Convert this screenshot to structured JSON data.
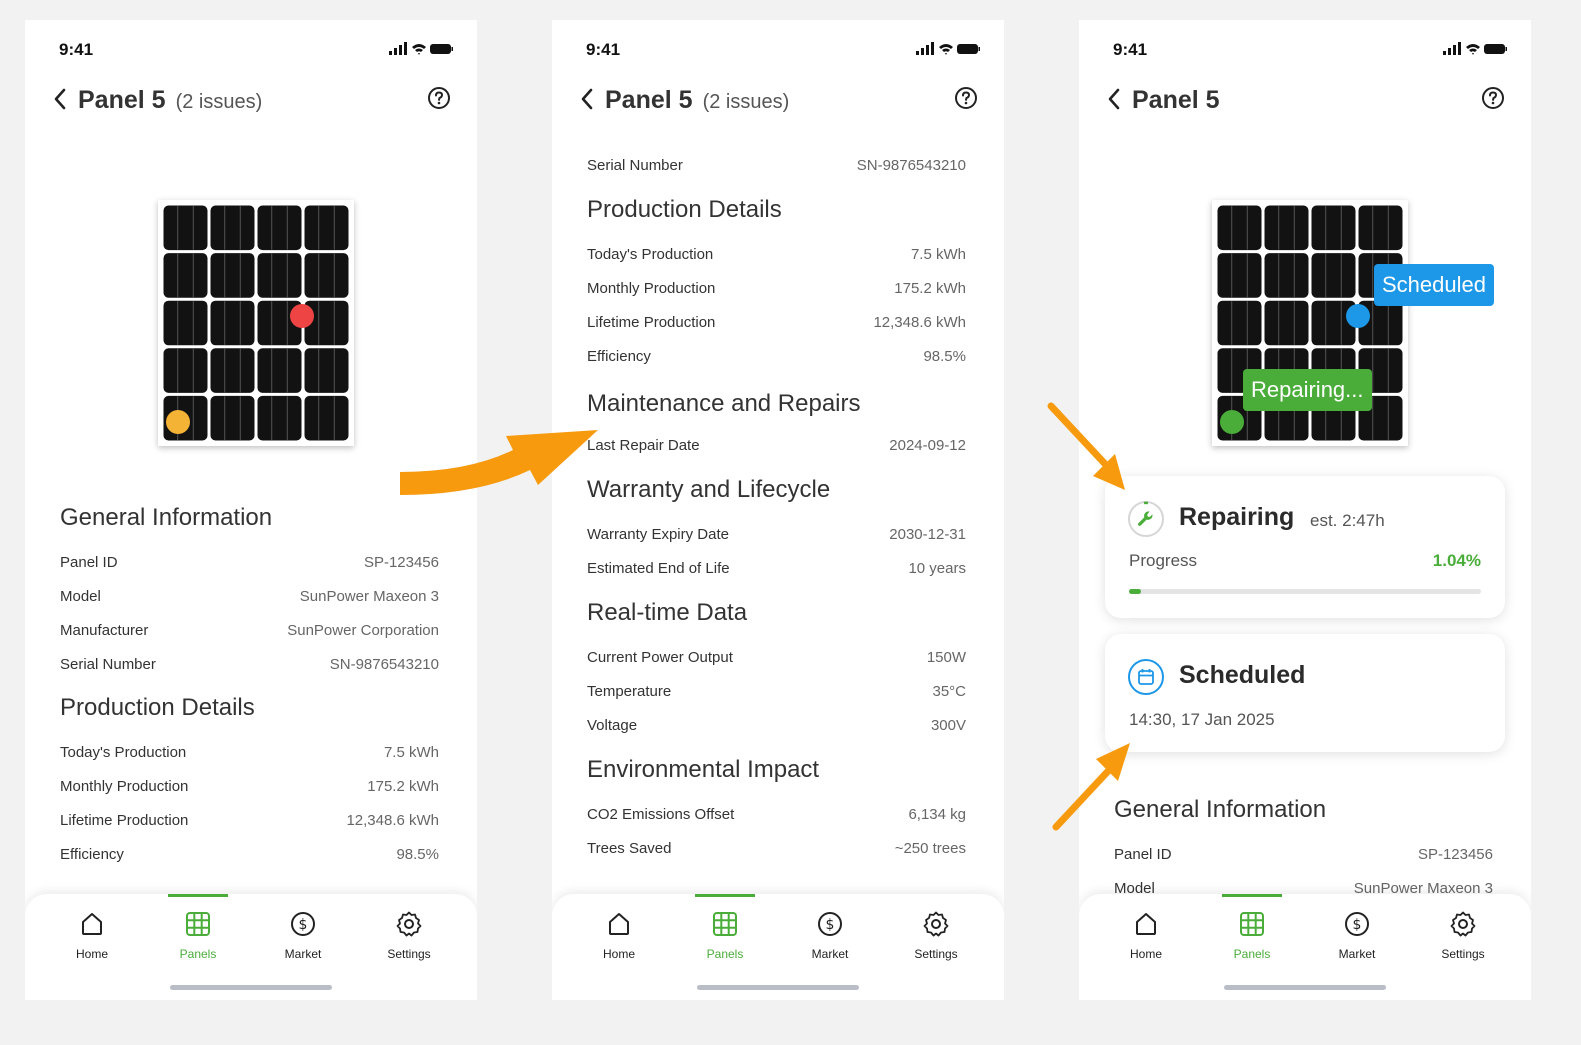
{
  "status": {
    "time": "9:41"
  },
  "colors": {
    "accent": "#4aad3a",
    "issue_red": "#ef4444",
    "issue_yellow": "#f5b335",
    "scheduled_blue": "#1d97e8",
    "arrow_orange": "#f79a0e"
  },
  "icons": {
    "back": "chevron-left-icon",
    "help": "question-circle-icon",
    "repair": "wrench-icon",
    "scheduled": "calendar-icon"
  },
  "screen1": {
    "title": "Panel 5",
    "issues": "(2 issues)",
    "general_title": "General Information",
    "general": [
      {
        "label": "Panel ID",
        "value": "SP-123456"
      },
      {
        "label": "Model",
        "value": "SunPower Maxeon 3"
      },
      {
        "label": "Manufacturer",
        "value": "SunPower Corporation"
      },
      {
        "label": "Serial Number",
        "value": "SN-9876543210"
      }
    ],
    "production_title": "Production Details",
    "production": [
      {
        "label": "Today's Production",
        "value": "7.5 kWh"
      },
      {
        "label": "Monthly Production",
        "value": "175.2 kWh"
      },
      {
        "label": "Lifetime Production",
        "value": "12,348.6 kWh"
      },
      {
        "label": "Efficiency",
        "value": "98.5%"
      }
    ]
  },
  "screen2": {
    "title": "Panel 5",
    "issues": "(2 issues)",
    "serial": {
      "label": "Serial Number",
      "value": "SN-9876543210"
    },
    "production_title": "Production Details",
    "production": [
      {
        "label": "Today's Production",
        "value": "7.5 kWh"
      },
      {
        "label": "Monthly Production",
        "value": "175.2 kWh"
      },
      {
        "label": "Lifetime Production",
        "value": "12,348.6 kWh"
      },
      {
        "label": "Efficiency",
        "value": "98.5%"
      }
    ],
    "maintenance_title": "Maintenance and Repairs",
    "maintenance": [
      {
        "label": "Last Repair Date",
        "value": "2024-09-12"
      }
    ],
    "warranty_title": "Warranty and Lifecycle",
    "warranty": [
      {
        "label": "Warranty Expiry Date",
        "value": "2030-12-31"
      },
      {
        "label": "Estimated End of Life",
        "value": "10 years"
      }
    ],
    "realtime_title": "Real-time Data",
    "realtime": [
      {
        "label": "Current Power Output",
        "value": "150W"
      },
      {
        "label": "Temperature",
        "value": "35°C"
      },
      {
        "label": "Voltage",
        "value": "300V"
      }
    ],
    "env_title": "Environmental Impact",
    "env": [
      {
        "label": "CO2 Emissions Offset",
        "value": "6,134 kg"
      },
      {
        "label": "Trees Saved",
        "value": "~250 trees"
      }
    ]
  },
  "screen3": {
    "title": "Panel 5",
    "badge_scheduled": "Scheduled",
    "badge_repairing": "Repairing...",
    "repair_card": {
      "title": "Repairing",
      "est": "est. 2:47h",
      "progress_label": "Progress",
      "progress_value": "1.04%",
      "progress_fraction": 0.0104
    },
    "scheduled_card": {
      "title": "Scheduled",
      "datetime": "14:30, 17 Jan 2025"
    },
    "general_title": "General Information",
    "general": [
      {
        "label": "Panel ID",
        "value": "SP-123456"
      },
      {
        "label": "Model",
        "value": "SunPower Maxeon 3"
      }
    ]
  },
  "nav": {
    "items": [
      {
        "label": "Home",
        "icon": "home-icon"
      },
      {
        "label": "Panels",
        "icon": "grid-icon"
      },
      {
        "label": "Market",
        "icon": "dollar-icon"
      },
      {
        "label": "Settings",
        "icon": "gear-icon"
      }
    ],
    "active": "Panels"
  }
}
